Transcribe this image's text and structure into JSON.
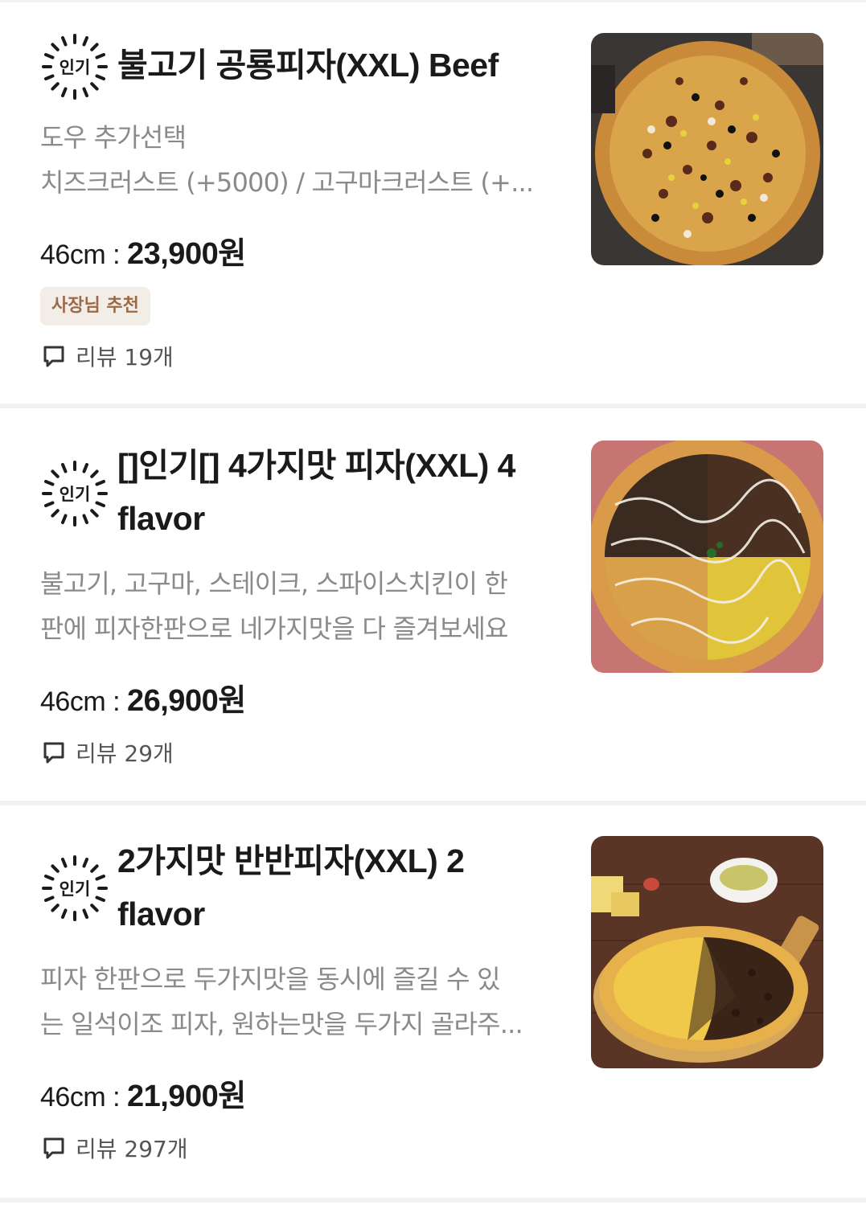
{
  "badge_label": "인기",
  "items": [
    {
      "title": "불고기 공룡피자(XXL) Beef",
      "desc_lines": [
        "도우 추가선택",
        "치즈크러스트 (+5000) / 고구마크러스트 (+..."
      ],
      "size": "46cm : ",
      "price": "23,900원",
      "tag": "사장님 추천",
      "review_label": "리뷰 19개",
      "image_icon": "bulgogi-pizza-photo"
    },
    {
      "title": "[]인기[] 4가지맛 피자(XXL) 4 flavor",
      "title_lines": [
        "[]인기[] 4가지맛 피자(XXL) 4",
        "flavor"
      ],
      "desc_lines": [
        "불고기, 고구마, 스테이크, 스파이스치킨이 한",
        "판에  피자한판으로 네가지맛을 다 즐겨보세요"
      ],
      "size": "46cm : ",
      "price": "26,900원",
      "review_label": "리뷰 29개",
      "image_icon": "four-flavor-pizza-photo"
    },
    {
      "title": "2가지맛 반반피자(XXL) 2 flavor",
      "title_lines": [
        "2가지맛 반반피자(XXL) 2",
        "flavor"
      ],
      "desc_lines": [
        "피자 한판으로 두가지맛을 동시에 즐길 수 있",
        "는 일석이조 피자, 원하는맛을 두가지 골라주..."
      ],
      "size": "46cm : ",
      "price": "21,900원",
      "review_label": "리뷰 297개",
      "image_icon": "half-half-pizza-photo"
    }
  ],
  "colors": {
    "title": "#1a1a1a",
    "desc": "#8a8a8a",
    "tag_text": "#9a6a4a",
    "tag_bg": "#f3ede7",
    "divider": "#f2f2f2"
  }
}
